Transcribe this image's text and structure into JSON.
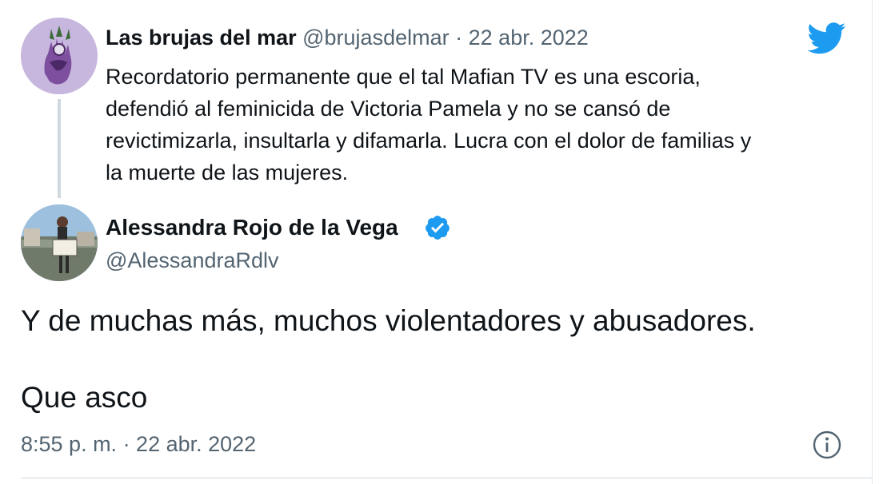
{
  "quoted_tweet": {
    "display_name": "Las brujas del mar",
    "handle": "@brujasdelmar",
    "separator": "·",
    "date": "22 abr. 2022",
    "text_lines": [
      "Recordatorio permanente que el tal Mafian TV es una escoria,",
      "defendió al feminicida de Victoria Pamela y no se cansó de",
      "revictimizarla, insultarla y difamarla. Lucra con el dolor de familias y",
      "la muerte de las mujeres."
    ]
  },
  "main_tweet": {
    "display_name": "Alessandra Rojo de la Vega",
    "handle": "@AlessandraRdlv",
    "text_line1": "Y de muchas más, muchos violentadores y abusadores.",
    "text_line2": "Que asco",
    "timestamp": "8:55 p. m. · 22 abr. 2022"
  },
  "icons": {
    "brand": "twitter-bird-icon",
    "verified": "verified-badge-icon",
    "info": "info-icon"
  },
  "colors": {
    "twitter_blue": "#1d9bf0",
    "secondary_text": "#536471",
    "primary_text": "#0f1419",
    "avatar1_bg": "#c7b7df"
  }
}
